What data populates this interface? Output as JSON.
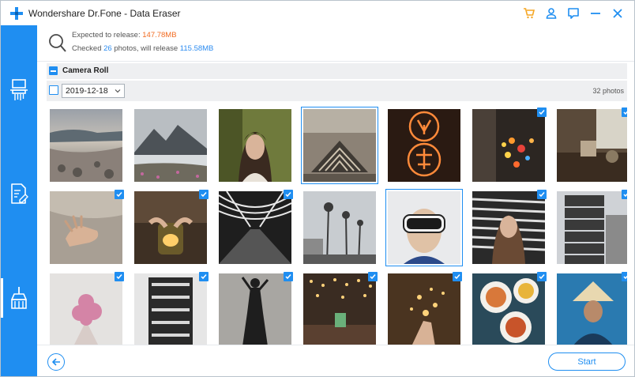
{
  "window": {
    "title": "Wondershare Dr.Fone - Data Eraser",
    "brand_color": "#1f8ef1",
    "cart_color": "#f5a623",
    "title_icons": [
      "cart-icon",
      "account-icon",
      "feedback-icon",
      "minimize-icon",
      "close-icon"
    ]
  },
  "sidebar": {
    "items": [
      {
        "name": "erase-all-data-icon",
        "active": false
      },
      {
        "name": "erase-private-data-icon",
        "active": false
      },
      {
        "name": "free-up-space-icon",
        "active": true
      }
    ]
  },
  "summary": {
    "expected_label": "Expected to release: ",
    "expected_value": "147.78MB",
    "checked_prefix": "Checked ",
    "checked_count": "26",
    "checked_middle": " photos, will release ",
    "checked_size": "115.58MB"
  },
  "group": {
    "label": "Camera Roll"
  },
  "date_filter": {
    "selected": "2019-12-18",
    "photo_count": "32 photos"
  },
  "photos": [
    {
      "subject": "rocky-beach",
      "checked": false,
      "selected": false
    },
    {
      "subject": "mountain-coast",
      "checked": false,
      "selected": false
    },
    {
      "subject": "woman-portrait",
      "checked": false,
      "selected": false
    },
    {
      "subject": "glass-pattern",
      "checked": false,
      "selected": true
    },
    {
      "subject": "neon-sign",
      "checked": false,
      "selected": false
    },
    {
      "subject": "bokeh-lights",
      "checked": true,
      "selected": false
    },
    {
      "subject": "table-interior",
      "checked": true,
      "selected": false
    },
    {
      "subject": "hand-sand",
      "checked": true,
      "selected": false
    },
    {
      "subject": "candle-jar",
      "checked": true,
      "selected": false
    },
    {
      "subject": "tunnel",
      "checked": true,
      "selected": false
    },
    {
      "subject": "palm-street",
      "checked": false,
      "selected": false
    },
    {
      "subject": "vr-headset-boy",
      "checked": false,
      "selected": true
    },
    {
      "subject": "woman-blinds",
      "checked": true,
      "selected": false
    },
    {
      "subject": "building",
      "checked": true,
      "selected": false
    },
    {
      "subject": "pink-flowers",
      "checked": true,
      "selected": false
    },
    {
      "subject": "building-night",
      "checked": true,
      "selected": false
    },
    {
      "subject": "dancer-silhouette",
      "checked": true,
      "selected": false
    },
    {
      "subject": "fairy-lights-table",
      "checked": true,
      "selected": false
    },
    {
      "subject": "sparkler-hand",
      "checked": true,
      "selected": false
    },
    {
      "subject": "food-plates",
      "checked": true,
      "selected": false
    },
    {
      "subject": "woman-hat",
      "checked": true,
      "selected": false
    }
  ],
  "footer": {
    "back_icon": "back-arrow-icon",
    "start_label": "Start"
  }
}
